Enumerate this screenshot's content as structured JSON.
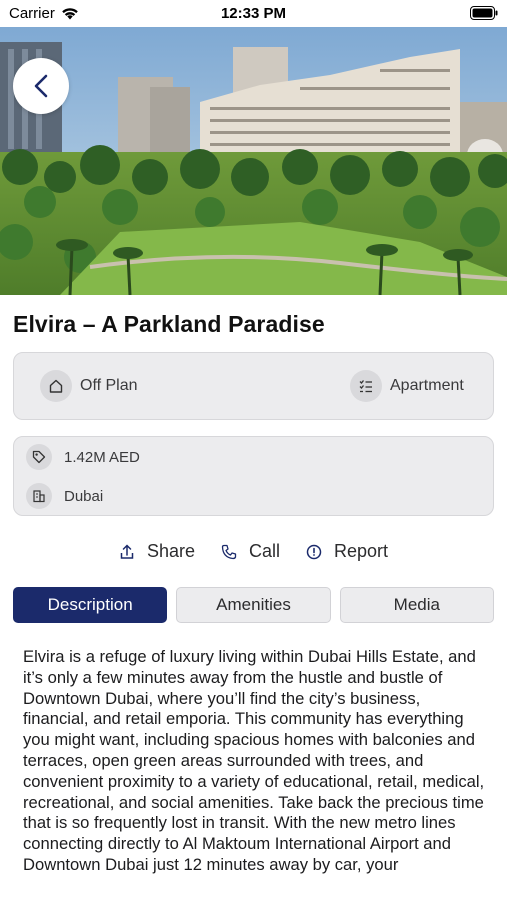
{
  "status_bar": {
    "carrier": "Carrier",
    "time": "12:33 PM"
  },
  "hero": {
    "image": "dubai-hills-parkland-rendering"
  },
  "listing": {
    "title": "Elvira – A Parkland Paradise",
    "status": "Off Plan",
    "property_type": "Apartment",
    "price": "1.42M AED",
    "location": "Dubai"
  },
  "actions": {
    "share": "Share",
    "call": "Call",
    "report": "Report"
  },
  "tabs": [
    {
      "label": "Description",
      "active": true
    },
    {
      "label": "Amenities",
      "active": false
    },
    {
      "label": "Media",
      "active": false
    }
  ],
  "description": "Elvira is a refuge of luxury living within Dubai Hills Estate, and it’s only a few minutes away from the hustle and bustle of Downtown Dubai, where you’ll find the city’s business, financial, and retail emporia. This community has everything you might want, including spacious homes with balconies and terraces, open green areas surrounded with trees, and convenient proximity to a variety of educational, retail, medical, recreational, and social amenities. Take back the precious time that is so frequently lost in transit. With the new metro lines connecting directly to Al Maktoum International Airport and Downtown Dubai just 12 minutes away by car, your",
  "colors": {
    "accent": "#1b2a6b",
    "card_bg": "#ececee"
  },
  "icons": {
    "back": "chevron-left-icon",
    "status": "home-icon",
    "type": "checklist-icon",
    "price": "price-tag-icon",
    "location": "building-icon",
    "share": "share-icon",
    "call": "phone-icon",
    "report": "report-icon"
  }
}
